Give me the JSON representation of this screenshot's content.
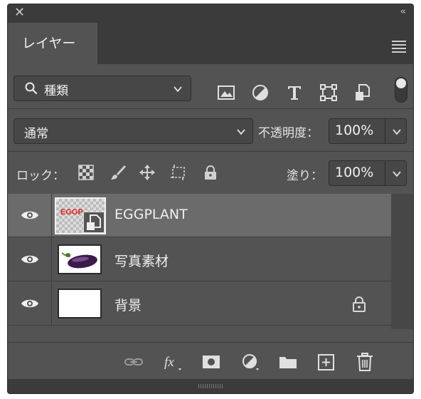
{
  "panel": {
    "tab_label": "レイヤー",
    "close_glyph": "✕",
    "collapse_glyph": "‹‹"
  },
  "filter": {
    "kind_label": "種類",
    "icons": [
      "image-filter-icon",
      "adjustment-filter-icon",
      "type-filter-icon",
      "shape-filter-icon",
      "smart-object-filter-icon"
    ]
  },
  "blend": {
    "mode_label": "通常",
    "opacity_label": "不透明度：",
    "opacity_value": "100%"
  },
  "lock": {
    "label": "ロック：",
    "fill_label": "塗り：",
    "fill_value": "100%"
  },
  "layers": [
    {
      "name": "EGGPLANT",
      "selected": true,
      "thumb_text": "EGGP",
      "locked": false
    },
    {
      "name": "写真素材",
      "selected": false,
      "locked": false
    },
    {
      "name": "背景",
      "selected": false,
      "locked": true
    }
  ],
  "bottom_icons": [
    "link-layers-icon",
    "fx-icon",
    "layer-mask-icon",
    "adjustment-layer-icon",
    "new-group-icon",
    "new-layer-icon",
    "delete-layer-icon"
  ],
  "colors": {
    "panel_bg": "#535353",
    "header_bg": "#3b3b3b",
    "selected_row": "#6b6b6b",
    "thumb_text_red": "#e11d1d"
  }
}
